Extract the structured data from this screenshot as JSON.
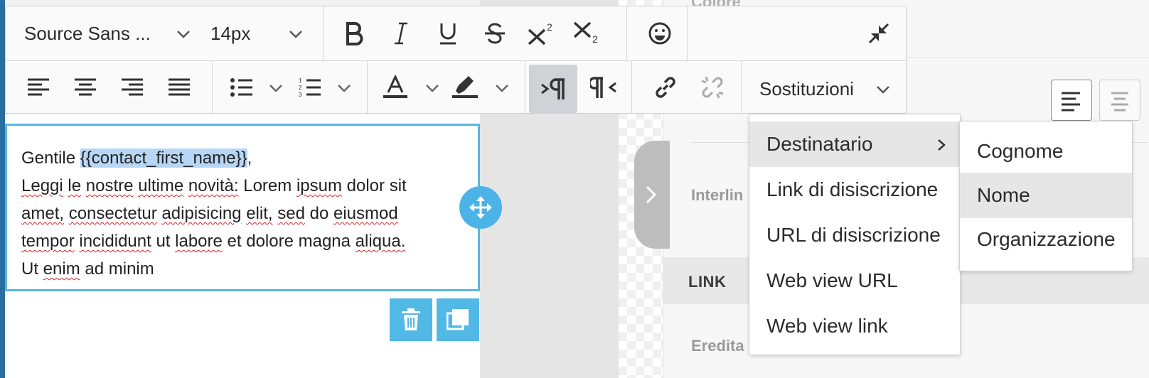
{
  "colors": {
    "accent": "#5ab5e2",
    "selection": "#b7d6f5",
    "active_button": "#cfd2d6"
  },
  "toolbar": {
    "font_family_value": "Source Sans ...",
    "font_size_value": "14px",
    "icons": [
      "bold-icon",
      "italic-icon",
      "underline-icon",
      "strikethrough-icon",
      "superscript-icon",
      "subscript-icon",
      "emoji-icon",
      "collapse-icon",
      "align-left-icon",
      "align-center-icon",
      "align-right-icon",
      "align-justify-icon",
      "bullet-list-icon",
      "numbered-list-icon",
      "text-color-icon",
      "highlight-color-icon",
      "ltr-icon",
      "rtl-icon",
      "link-icon",
      "unlink-icon"
    ],
    "sostituzioni_label": "Sostituzioni"
  },
  "editor": {
    "greeting_prefix": "Gentile ",
    "placeholder_token": "{{contact_first_name}}",
    "greeting_suffix": ",",
    "w_leggi": "Leggi",
    "w_le": "le",
    "w_nostre": "nostre",
    "w_ultime": "ultime",
    "w_novita": "novità:",
    "w_lorem": "Lorem",
    "w_ipsum": "ipsum",
    "w_dolor": "dolor",
    "w_sit": "sit",
    "w_amet": "amet,",
    "w_consectetur": "consectetur",
    "w_adipisicing": "adipisicing",
    "w_elit": "elit,",
    "w_sed": "sed",
    "w_do": "do",
    "w_eiusmod": "eiusmod",
    "w_tempor": "tempor",
    "w_incididunt": "incididunt",
    "w_ut": "ut",
    "w_labore": "labore",
    "w_et": "et",
    "w_dolore": "dolore",
    "w_magna": "magna",
    "w_aliqua": "aliqua.",
    "w_Ut": "Ut",
    "w_enim": "enim",
    "w_ad": "ad",
    "w_minim": "minim"
  },
  "menu": {
    "items": [
      {
        "label": "Destinatario"
      },
      {
        "label": "Link di disiscrizione"
      },
      {
        "label": "URL di disiscrizione"
      },
      {
        "label": "Web view URL"
      },
      {
        "label": "Web view link"
      }
    ],
    "submenu": [
      {
        "label": "Cognome"
      },
      {
        "label": "Nome"
      },
      {
        "label": "Organizzazione"
      }
    ]
  },
  "panel": {
    "top_label": "Colore",
    "interlinea_label": "Interlin",
    "link_label": "LINK",
    "ereditato_label": "Eredita"
  }
}
